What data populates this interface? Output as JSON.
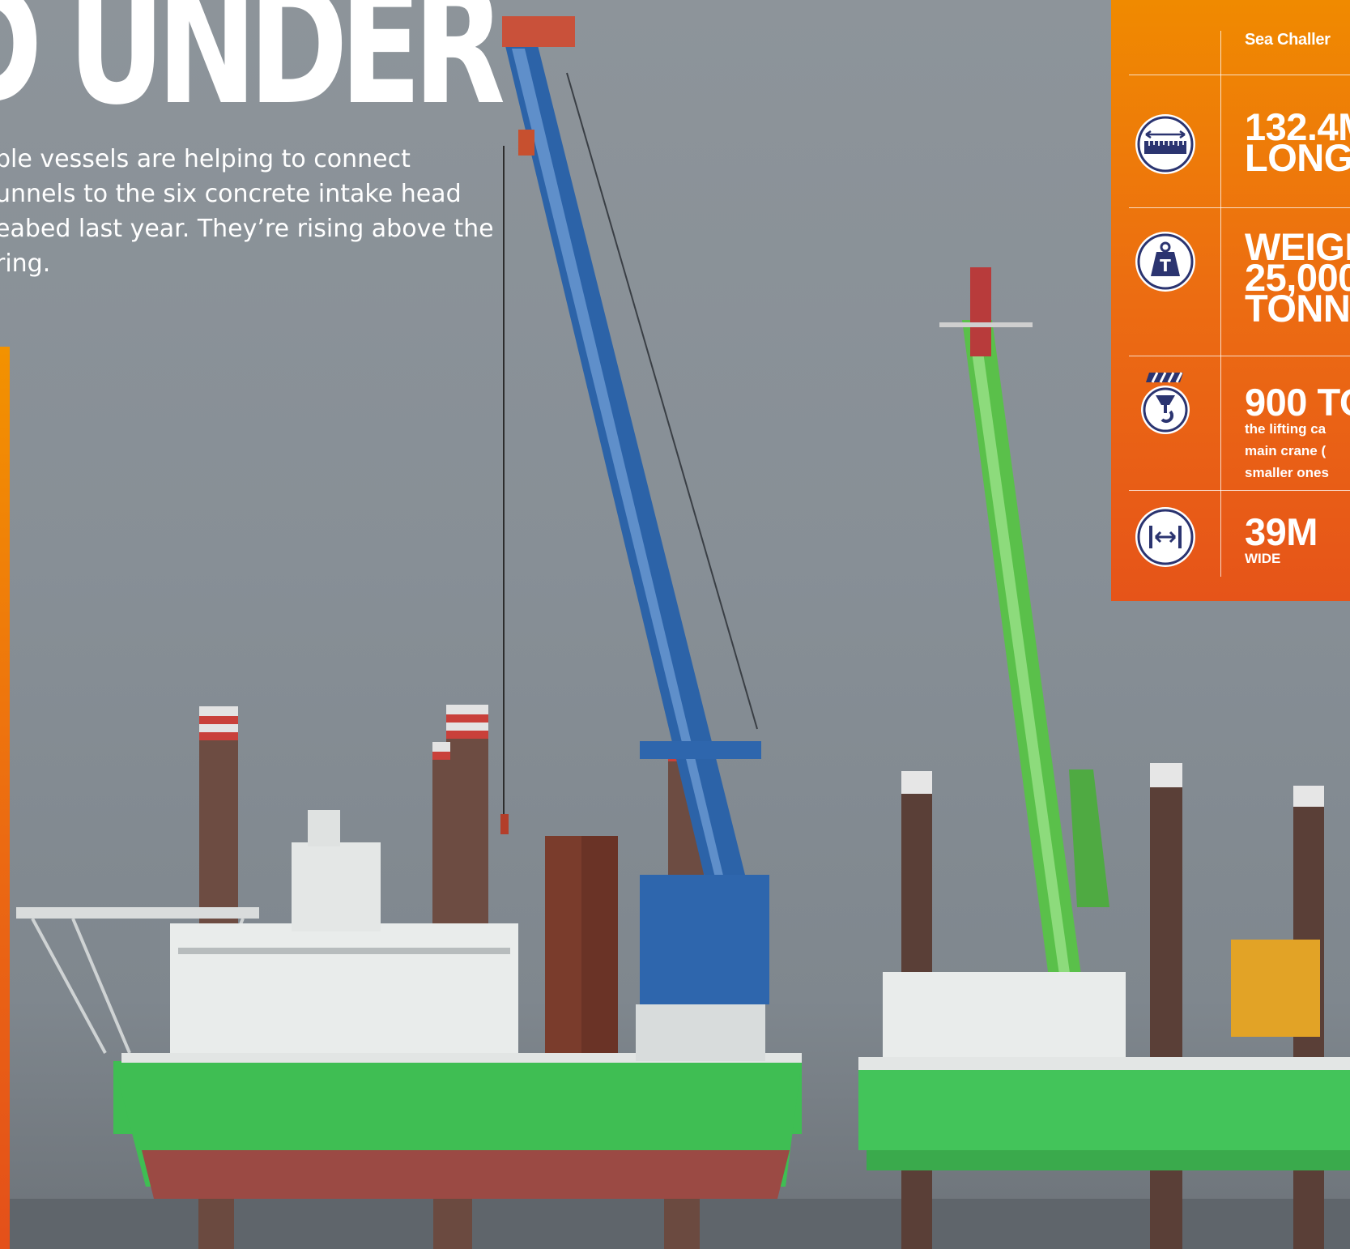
{
  "article": {
    "headline": "D UNDER",
    "intro_lines": [
      "ble vessels are helping to connect",
      "unnels to the six concrete intake head",
      "eabed last year. They’re rising above the",
      "ring."
    ]
  },
  "fact_panel": {
    "vessel_name": "Sea Challer",
    "facts": [
      {
        "icon": "length-ruler-icon",
        "value_lines": [
          "132.4M",
          "LONG"
        ],
        "note_lines": []
      },
      {
        "icon": "weight-icon",
        "icon_letter": "T",
        "value_lines": [
          "WEIGH",
          "25,000",
          "TONNE"
        ],
        "note_lines": []
      },
      {
        "icon": "crane-hook-icon",
        "value_lines": [
          "900 TO"
        ],
        "note_lines": [
          "the lifting ca",
          "main crane (",
          "smaller ones"
        ]
      },
      {
        "icon": "width-arrows-icon",
        "value_lines": [
          "39M"
        ],
        "note_lines": [
          "WIDE"
        ]
      }
    ]
  },
  "colors": {
    "panel_orange_top": "#f08a00",
    "panel_orange_bottom": "#e65419",
    "icon_navy": "#2b3470",
    "vessel_green": "#3fbe53",
    "hull_red": "#9b4a44",
    "crane_blue": "#2c63a8"
  }
}
